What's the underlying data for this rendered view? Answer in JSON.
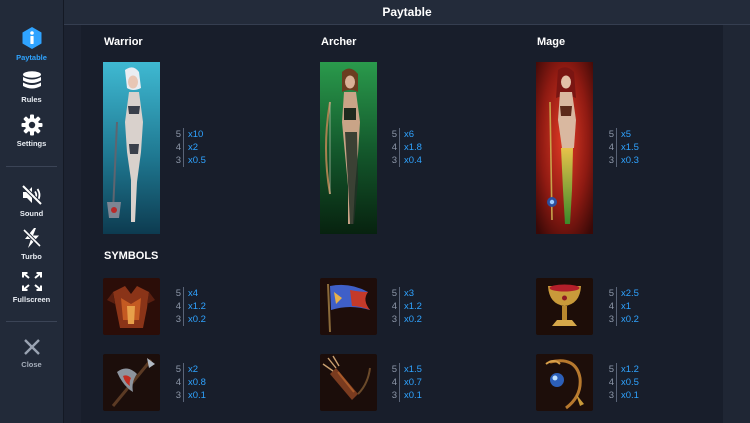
{
  "sidebar": {
    "paytable_label": "Paytable",
    "rules_label": "Rules",
    "settings_label": "Settings",
    "sound_label": "Sound",
    "turbo_label": "Turbo",
    "fullscreen_label": "Fullscreen",
    "close_label": "Close"
  },
  "header": {
    "title": "Paytable"
  },
  "heroes": [
    {
      "name": "Warrior",
      "pays": [
        {
          "count": "5",
          "mult": "x10"
        },
        {
          "count": "4",
          "mult": "x2"
        },
        {
          "count": "3",
          "mult": "x0.5"
        }
      ]
    },
    {
      "name": "Archer",
      "pays": [
        {
          "count": "5",
          "mult": "x6"
        },
        {
          "count": "4",
          "mult": "x1.8"
        },
        {
          "count": "3",
          "mult": "x0.4"
        }
      ]
    },
    {
      "name": "Mage",
      "pays": [
        {
          "count": "5",
          "mult": "x5"
        },
        {
          "count": "4",
          "mult": "x1.5"
        },
        {
          "count": "3",
          "mult": "x0.3"
        }
      ]
    }
  ],
  "symbols_heading": "SYMBOLS",
  "symbols": [
    {
      "icon": "armor-icon",
      "pays": [
        {
          "count": "5",
          "mult": "x4"
        },
        {
          "count": "4",
          "mult": "x1.2"
        },
        {
          "count": "3",
          "mult": "x0.2"
        }
      ]
    },
    {
      "icon": "banner-icon",
      "pays": [
        {
          "count": "5",
          "mult": "x3"
        },
        {
          "count": "4",
          "mult": "x1.2"
        },
        {
          "count": "3",
          "mult": "x0.2"
        }
      ]
    },
    {
      "icon": "goblet-icon",
      "pays": [
        {
          "count": "5",
          "mult": "x2.5"
        },
        {
          "count": "4",
          "mult": "x1"
        },
        {
          "count": "3",
          "mult": "x0.2"
        }
      ]
    },
    {
      "icon": "axe-icon",
      "pays": [
        {
          "count": "5",
          "mult": "x2"
        },
        {
          "count": "4",
          "mult": "x0.8"
        },
        {
          "count": "3",
          "mult": "x0.1"
        }
      ]
    },
    {
      "icon": "quiver-icon",
      "pays": [
        {
          "count": "5",
          "mult": "x1.5"
        },
        {
          "count": "4",
          "mult": "x0.7"
        },
        {
          "count": "3",
          "mult": "x0.1"
        }
      ]
    },
    {
      "icon": "staff-icon",
      "pays": [
        {
          "count": "5",
          "mult": "x1.2"
        },
        {
          "count": "4",
          "mult": "x0.5"
        },
        {
          "count": "3",
          "mult": "x0.1"
        }
      ]
    }
  ],
  "colors": {
    "accent": "#2fa3ff",
    "panel": "#181e2b",
    "sidebar": "#222a39"
  }
}
